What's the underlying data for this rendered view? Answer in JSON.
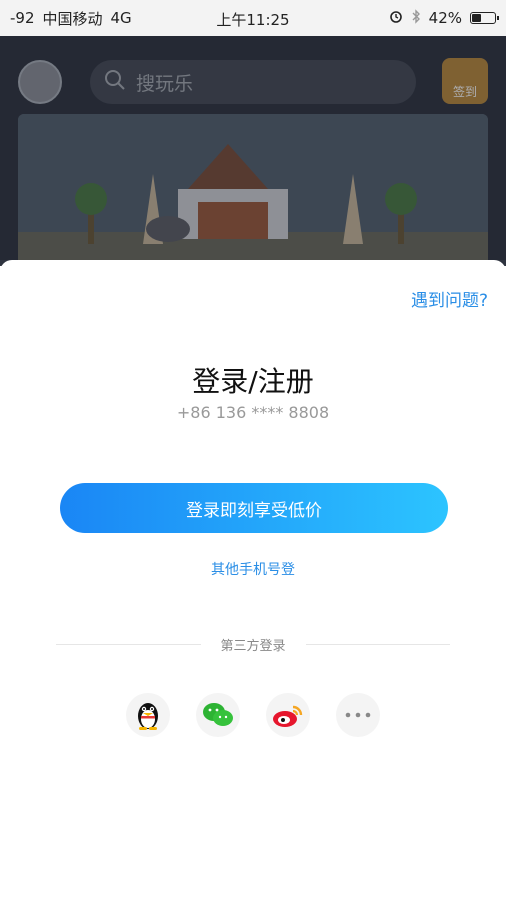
{
  "status_bar": {
    "signal": "-92",
    "carrier": "中国移动",
    "network": "4G",
    "time": "上午11:25",
    "battery_percent": "42%",
    "battery_level": 0.42
  },
  "background_app": {
    "search_placeholder": "搜玩乐",
    "sign_badge": "签到"
  },
  "login_sheet": {
    "help_link": "遇到问题?",
    "title": "登录/注册",
    "phone_number": "+86 136 **** 8808",
    "login_button": "登录即刻享受低价",
    "other_phone_link": "其他手机号登",
    "third_party_label": "第三方登录",
    "social_icons": [
      "qq-icon",
      "wechat-icon",
      "weibo-icon",
      "more-icon"
    ]
  },
  "colors": {
    "accent_blue": "#2a8ee6",
    "button_gradient_start": "#1a86f5",
    "button_gradient_end": "#2cc4ff",
    "dim_background": "#2f3440"
  }
}
